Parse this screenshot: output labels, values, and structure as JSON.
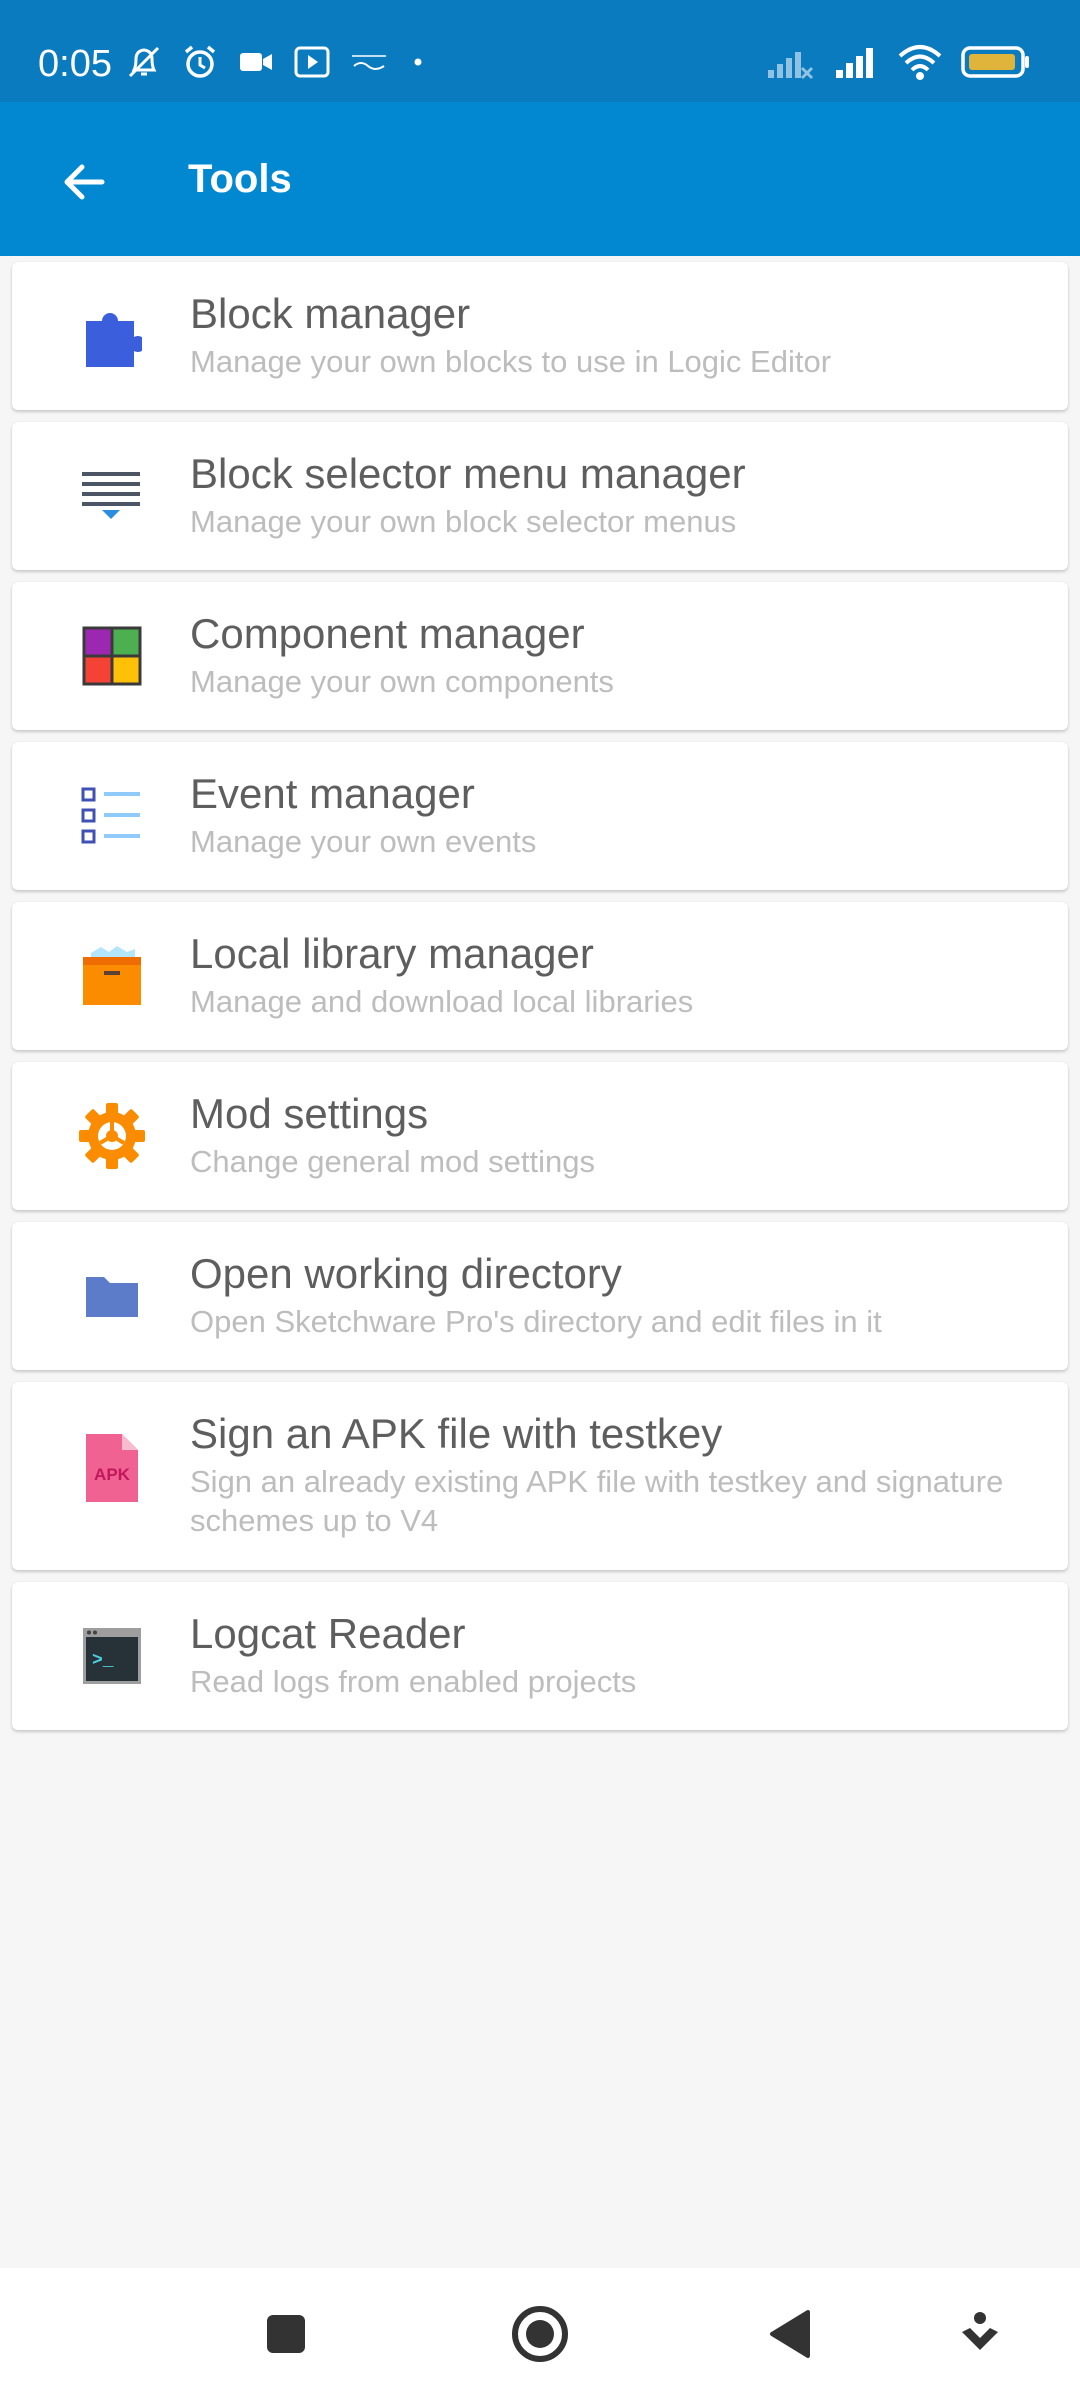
{
  "status_bar": {
    "time": "0:05",
    "icons_left": [
      "mute-alarm-icon",
      "alarm-icon",
      "video-icon",
      "youtube-icon",
      "onda-icon",
      "dot-icon"
    ],
    "icons_right": [
      "signal-off-icon",
      "signal-icon",
      "wifi-icon",
      "battery-icon"
    ],
    "battery_color": "#e0b43a"
  },
  "app_bar": {
    "title": "Tools",
    "back_icon": "arrow-back-icon",
    "color": "#0288d1"
  },
  "items": [
    {
      "title": "Block manager",
      "subtitle": "Manage your own blocks to use in Logic Editor",
      "icon": "puzzle-icon"
    },
    {
      "title": "Block selector menu manager",
      "subtitle": "Manage your own block selector menus",
      "icon": "menu-lines-icon"
    },
    {
      "title": "Component manager",
      "subtitle": "Manage your own components",
      "icon": "component-grid-icon"
    },
    {
      "title": "Event manager",
      "subtitle": "Manage your own events",
      "icon": "checklist-icon"
    },
    {
      "title": "Local library manager",
      "subtitle": "Manage and download local libraries",
      "icon": "box-icon"
    },
    {
      "title": "Mod settings",
      "subtitle": "Change general mod settings",
      "icon": "gear-icon"
    },
    {
      "title": "Open working directory",
      "subtitle": "Open Sketchware Pro's directory and edit files in it",
      "icon": "folder-icon"
    },
    {
      "title": "Sign an APK file with testkey",
      "subtitle": "Sign an already existing APK file with testkey and signature schemes up to V4",
      "icon": "apk-file-icon",
      "icon_text": "APK"
    },
    {
      "title": "Logcat Reader",
      "subtitle": "Read logs from enabled projects",
      "icon": "terminal-icon",
      "icon_text": ">_"
    }
  ],
  "nav_bar": {
    "buttons": [
      "recents-square-icon",
      "home-circle-icon",
      "back-triangle-icon",
      "assistant-icon"
    ]
  }
}
